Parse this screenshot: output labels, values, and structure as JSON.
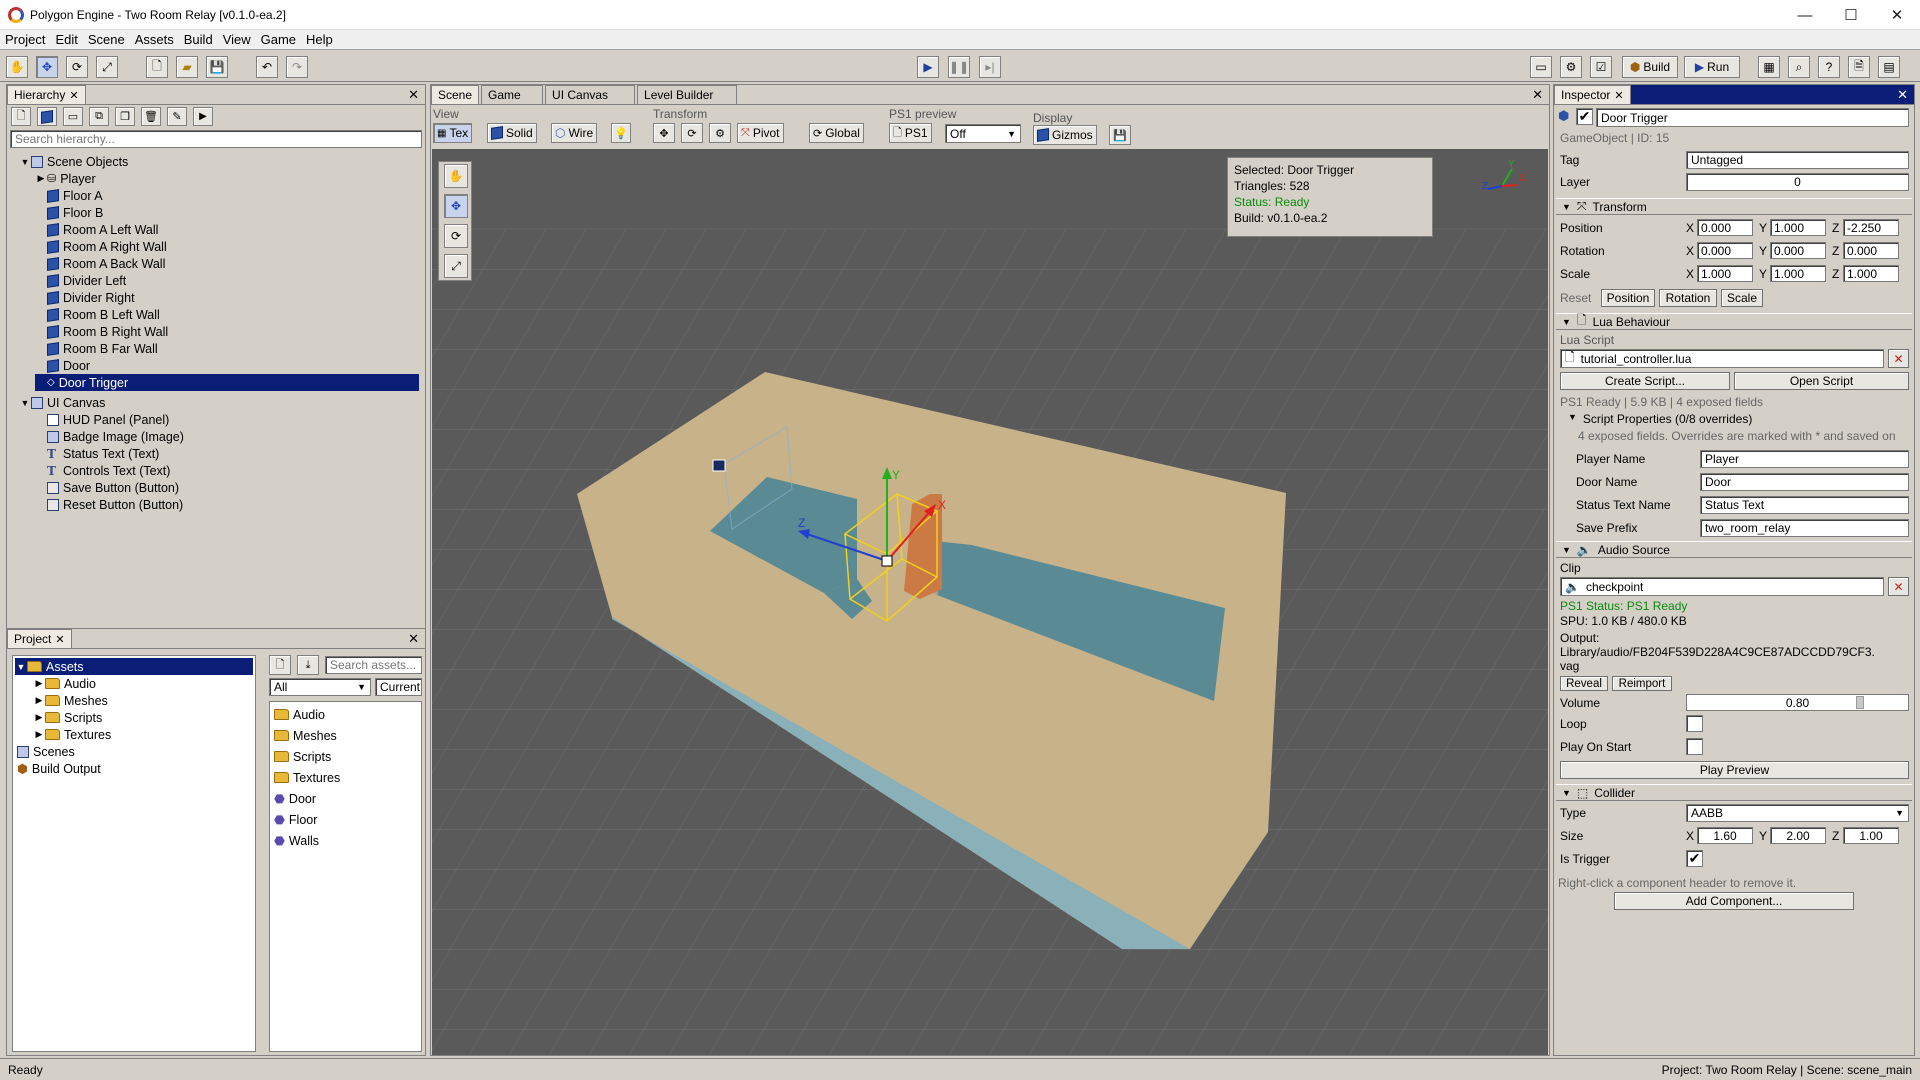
{
  "window": {
    "title": "Polygon Engine - Two Room Relay [v0.1.0-ea.2]",
    "controls": [
      "—",
      "☐",
      "✕"
    ]
  },
  "menu": [
    "Project",
    "Edit",
    "Scene",
    "Assets",
    "Build",
    "View",
    "Game",
    "Help"
  ],
  "toolbar": {
    "build_label": "Build",
    "run_label": "Run"
  },
  "hierarchy": {
    "tab": "Hierarchy",
    "search_placeholder": "Search hierarchy...",
    "scene_objects_label": "Scene Objects",
    "items": [
      "Player",
      "Floor A",
      "Floor B",
      "Room A Left Wall",
      "Room A Right Wall",
      "Room A Back Wall",
      "Divider Left",
      "Divider Right",
      "Room B Left Wall",
      "Room B Right Wall",
      "Room B Far Wall",
      "Door",
      "Door Trigger"
    ],
    "ui_canvas_label": "UI Canvas",
    "ui_items": [
      "HUD Panel (Panel)",
      "Badge Image (Image)",
      "Status Text (Text)",
      "Controls Text (Text)",
      "Save Button (Button)",
      "Reset Button (Button)"
    ]
  },
  "project": {
    "tab": "Project",
    "tree_root": "Assets",
    "tree_children": [
      "Audio",
      "Meshes",
      "Scripts",
      "Textures"
    ],
    "scenes_label": "Scenes",
    "build_output_label": "Build Output",
    "search_placeholder": "Search assets...",
    "filter_value": "All",
    "scope_value": "Current f",
    "list_folders": [
      "Audio",
      "Meshes",
      "Scripts",
      "Textures"
    ],
    "list_assets": [
      "Door",
      "Floor",
      "Walls"
    ]
  },
  "viewport": {
    "tabs": [
      "Scene",
      "Game",
      "UI Canvas",
      "Level Builder"
    ],
    "group_view": "View",
    "group_transform": "Transform",
    "group_ps1": "PS1 preview",
    "group_display": "Display",
    "btn_tex": "Tex",
    "btn_solid": "Solid",
    "btn_wire": "Wire",
    "btn_pivot": "Pivot",
    "btn_global": "Global",
    "btn_ps1": "PS1",
    "ps1_select": "Off",
    "btn_gizmos": "Gizmos",
    "overlay": {
      "selected": "Selected: Door Trigger",
      "triangles": "Triangles: 528",
      "status": "Status: Ready",
      "build": "Build: v0.1.0-ea.2"
    },
    "axis_y": "Y",
    "axis_x": "X",
    "axis_z": "Z",
    "colors": {
      "ground": "#5e5e5e",
      "sand": "#c8b28a",
      "floor": "#5a8a94",
      "door": "#cc7a44",
      "selection": "#f0d020",
      "status_ok": "#0c8a0c"
    }
  },
  "inspector": {
    "tab": "Inspector",
    "object_name": "Door Trigger",
    "gameobject_id": "GameObject  |  ID: 15",
    "tag_label": "Tag",
    "tag_value": "Untagged",
    "layer_label": "Layer",
    "layer_value": "0",
    "transform": {
      "title": "Transform",
      "position_label": "Position",
      "position": [
        "0.000",
        "1.000",
        "-2.250"
      ],
      "rotation_label": "Rotation",
      "rotation": [
        "0.000",
        "0.000",
        "0.000"
      ],
      "scale_label": "Scale",
      "scale": [
        "1.000",
        "1.000",
        "1.000"
      ],
      "reset_label": "Reset",
      "reset_buttons": [
        "Position",
        "Rotation",
        "Scale"
      ]
    },
    "lua": {
      "title": "Lua Behaviour",
      "script_label": "Lua Script",
      "script_value": "tutorial_controller.lua",
      "create_button": "Create Script...",
      "open_button": "Open Script",
      "info": "PS1 Ready  |  5.9 KB  |  4 exposed fields",
      "props_title": "Script Properties (0/8 overrides)",
      "props_note": "4 exposed fields. Overrides are marked with * and saved on",
      "fields": [
        {
          "label": "Player Name",
          "value": "Player"
        },
        {
          "label": "Door Name",
          "value": "Door"
        },
        {
          "label": "Status Text Name",
          "value": "Status Text"
        },
        {
          "label": "Save Prefix",
          "value": "two_room_relay"
        }
      ]
    },
    "audio": {
      "title": "Audio Source",
      "clip_label": "Clip",
      "clip_value": "checkpoint",
      "ps1_status": "PS1 Status: PS1 Ready",
      "spu": "SPU: 1.0 KB / 480.0 KB",
      "output_label": "Output:",
      "output_path": "Library/audio/FB204F539D228A4C9CE87ADCCDD79CF3.",
      "output_ext": "vag",
      "reveal_button": "Reveal",
      "reimport_button": "Reimport",
      "volume_label": "Volume",
      "volume_value": "0.80",
      "volume_fraction": 0.8,
      "loop_label": "Loop",
      "play_on_start_label": "Play On Start",
      "play_preview_button": "Play Preview"
    },
    "collider": {
      "title": "Collider",
      "type_label": "Type",
      "type_value": "AABB",
      "size_label": "Size",
      "size": [
        "1.60",
        "2.00",
        "1.00"
      ],
      "is_trigger_label": "Is Trigger",
      "is_trigger": true
    },
    "hint": "Right-click a component header to remove it.",
    "add_component_button": "Add Component..."
  },
  "status": {
    "left": "Ready",
    "right": "Project: Two Room Relay  |  Scene: scene_main"
  }
}
